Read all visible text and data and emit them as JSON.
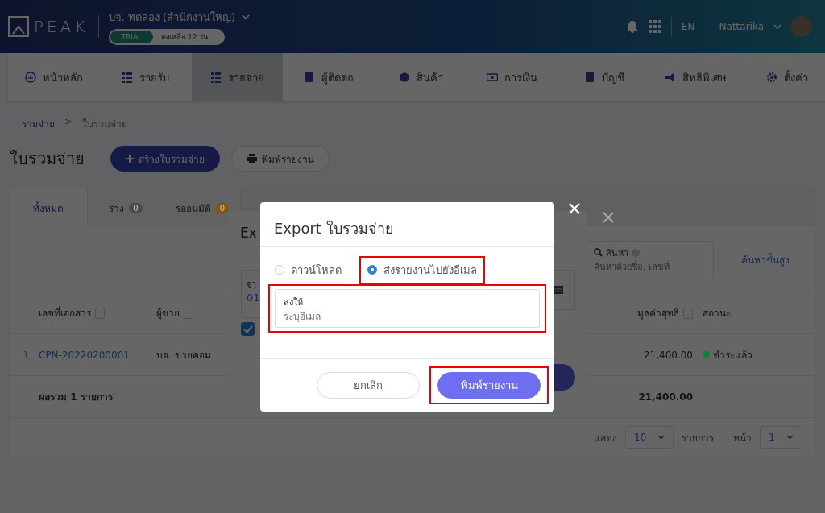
{
  "header": {
    "logo": "PEAK",
    "company": "บจ. ทดลอง (สำนักงานใหญ่)",
    "trial_badge": "TRIAL",
    "days_left": "คงเหลือ 12 วัน",
    "language": "EN",
    "user": "Nattarika"
  },
  "nav": [
    {
      "label": "หน้าหลัก",
      "selected": false
    },
    {
      "label": "รายรับ",
      "selected": false
    },
    {
      "label": "รายจ่าย",
      "selected": true
    },
    {
      "label": "ผู้ติดต่อ",
      "selected": false
    },
    {
      "label": "สินค้า",
      "selected": false
    },
    {
      "label": "การเงิน",
      "selected": false
    },
    {
      "label": "บัญชี",
      "selected": false
    },
    {
      "label": "สิทธิพิเศษ",
      "selected": false
    },
    {
      "label": "ตั้งค่า",
      "selected": false
    }
  ],
  "breadcrumb": [
    "รายจ่าย",
    "ใบรวมจ่าย"
  ],
  "breadcrumb_separator": ">",
  "page_title": "ใบรวมจ่าย",
  "actions": [
    {
      "label": "สร้างใบรวมจ่าย",
      "kind": "create"
    },
    {
      "label": "พิมพ์รายงาน",
      "kind": "print"
    }
  ],
  "tabs": [
    {
      "label": "ทั้งหมด",
      "selected": true
    },
    {
      "label": "ร่าง",
      "count": "0",
      "color": "#4a4a4a",
      "selected": false
    },
    {
      "label": "รออนุมัติ",
      "count": "0",
      "color": "#8a5510",
      "selected": false
    }
  ],
  "search": {
    "label": "ค้นหา",
    "placeholder": "ค้นหาด้วยชื่อ, เลขที่"
  },
  "advanced_search": "ค้นหาขั้นสูง",
  "table": {
    "columns": [
      "เลขที่เอกสาร",
      "ผู้ขาย",
      "มูลค่าสุทธิ",
      "สถานะ"
    ],
    "rows": [
      {
        "index": "1",
        "document": "CPN-20220200001",
        "vendor": "บจ. ขายคอม",
        "net": "21,400.00",
        "status": "ชำระแล้ว",
        "color": "#1d7a40"
      }
    ],
    "total": {
      "label": "ผลรวม 1 รายการ",
      "net": "21,400.00"
    }
  },
  "pagination": {
    "show_label": "แสดง",
    "per_page": "10",
    "unit_label": "รายการ",
    "page_label": "หน้า",
    "page": "1"
  },
  "back_dialog": {
    "title": "Ex",
    "field_label": "จา",
    "field_value": "01",
    "checked": true
  },
  "dialog": {
    "title": "Export ใบรวมจ่าย",
    "options": [
      {
        "label": "ดาวน์โหลด",
        "selected": false,
        "highlighted": false
      },
      {
        "label": "ส่งรายงานไปยังอีเมล",
        "selected": true,
        "highlighted": true
      }
    ],
    "email_field": {
      "label": "ส่งให้",
      "placeholder": "ระบุอีเมล",
      "highlighted": true
    },
    "buttons": [
      {
        "label": "ยกเลิก",
        "kind": "cancel",
        "highlighted": false
      },
      {
        "label": "พิมพ์รายงาน",
        "kind": "primary",
        "highlighted": true
      }
    ]
  }
}
